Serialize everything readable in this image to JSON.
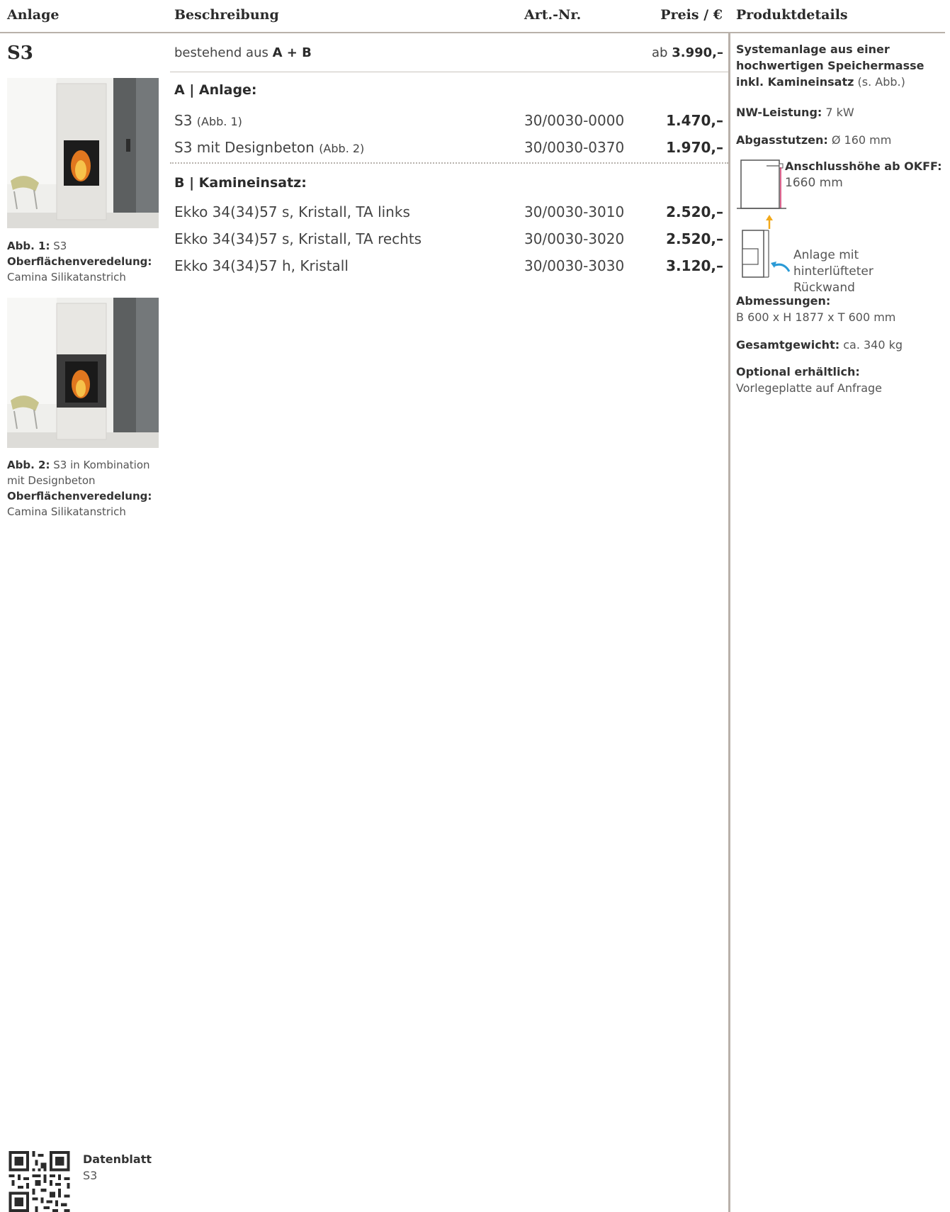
{
  "header": {
    "col_anlage": "Anlage",
    "col_beschreibung": "Beschreibung",
    "col_artnr": "Art.-Nr.",
    "col_preis": "Preis / €",
    "col_produktdetails": "Produktdetails"
  },
  "product": {
    "name": "S3",
    "subtitle_prefix": "bestehend aus",
    "subtitle_bold": "A + B",
    "price_prefix": "ab",
    "price": "3.990,–"
  },
  "section_a": {
    "title": "A | Anlage:",
    "items": [
      {
        "name": "S3",
        "note": "(Abb. 1)",
        "art": "30/0030-0000",
        "price": "1.470,–"
      },
      {
        "name": "S3 mit Designbeton",
        "note": "(Abb. 2)",
        "art": "30/0030-0370",
        "price": "1.970,–"
      }
    ]
  },
  "section_b": {
    "title": "B | Kamineinsatz:",
    "items": [
      {
        "name": "Ekko 34(34)57 s, Kristall, TA links",
        "art": "30/0030-3010",
        "price": "2.520,–"
      },
      {
        "name": "Ekko 34(34)57 s, Kristall, TA rechts",
        "art": "30/0030-3020",
        "price": "2.520,–"
      },
      {
        "name": "Ekko 34(34)57 h, Kristall",
        "art": "30/0030-3030",
        "price": "3.120,–"
      }
    ]
  },
  "captions": {
    "abb1_label": "Abb. 1:",
    "abb1_text": "S3",
    "abb1_surface_label": "Oberflächenveredelung:",
    "abb1_surface": "Camina Silikatanstrich",
    "abb2_label": "Abb. 2:",
    "abb2_text": "S3 in Kombination mit Designbeton",
    "abb2_surface_label": "Oberflächenveredelung:",
    "abb2_surface": "Camina Silikatanstrich"
  },
  "details": {
    "system_bold": "Systemanlage aus einer hochwertigen Speichermasse inkl. Kamineinsatz",
    "system_rest": "(s. Abb.)",
    "nw_label": "NW-Leistung:",
    "nw_value": "7 kW",
    "abgas_label": "Abgasstutzen:",
    "abgas_value": "Ø 160 mm",
    "anschluss_label": "Anschlusshöhe ab OKFF:",
    "anschluss_value": "1660 mm",
    "rueckwand_text": "Anlage mit hinterlüfteter Rückwand",
    "abm_label": "Abmessungen:",
    "abm_value": "B 600 x H 1877 x T 600 mm",
    "gewicht_label": "Gesamtgewicht:",
    "gewicht_value": "ca. 340 kg",
    "optional_label": "Optional erhältlich:",
    "optional_value": "Vorlegeplatte auf Anfrage"
  },
  "footer": {
    "title": "Datenblatt",
    "subtitle": "S3"
  },
  "colors": {
    "rule": "#b9b1aa",
    "text": "#3a3a3a",
    "arrow_orange": "#f2a91c",
    "arrow_blue": "#2a9ad6",
    "dimension_pink": "#d6336c"
  }
}
